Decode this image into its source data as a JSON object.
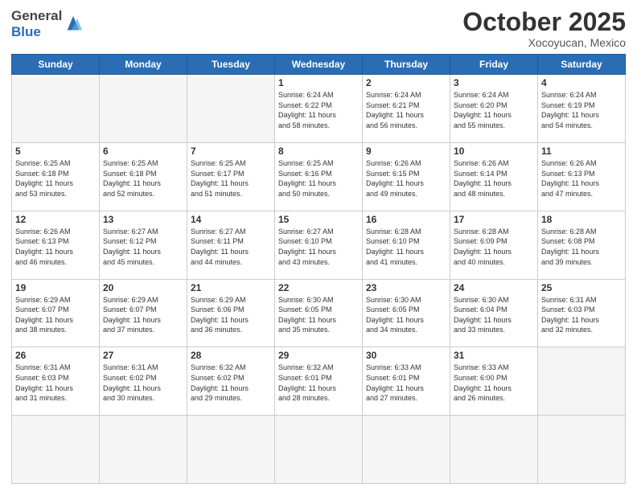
{
  "header": {
    "logo_general": "General",
    "logo_blue": "Blue",
    "month": "October 2025",
    "location": "Xocoyucan, Mexico"
  },
  "weekdays": [
    "Sunday",
    "Monday",
    "Tuesday",
    "Wednesday",
    "Thursday",
    "Friday",
    "Saturday"
  ],
  "days": [
    {
      "num": "",
      "info": ""
    },
    {
      "num": "",
      "info": ""
    },
    {
      "num": "",
      "info": ""
    },
    {
      "num": "1",
      "info": "Sunrise: 6:24 AM\nSunset: 6:22 PM\nDaylight: 11 hours\nand 58 minutes."
    },
    {
      "num": "2",
      "info": "Sunrise: 6:24 AM\nSunset: 6:21 PM\nDaylight: 11 hours\nand 56 minutes."
    },
    {
      "num": "3",
      "info": "Sunrise: 6:24 AM\nSunset: 6:20 PM\nDaylight: 11 hours\nand 55 minutes."
    },
    {
      "num": "4",
      "info": "Sunrise: 6:24 AM\nSunset: 6:19 PM\nDaylight: 11 hours\nand 54 minutes."
    },
    {
      "num": "5",
      "info": "Sunrise: 6:25 AM\nSunset: 6:18 PM\nDaylight: 11 hours\nand 53 minutes."
    },
    {
      "num": "6",
      "info": "Sunrise: 6:25 AM\nSunset: 6:18 PM\nDaylight: 11 hours\nand 52 minutes."
    },
    {
      "num": "7",
      "info": "Sunrise: 6:25 AM\nSunset: 6:17 PM\nDaylight: 11 hours\nand 51 minutes."
    },
    {
      "num": "8",
      "info": "Sunrise: 6:25 AM\nSunset: 6:16 PM\nDaylight: 11 hours\nand 50 minutes."
    },
    {
      "num": "9",
      "info": "Sunrise: 6:26 AM\nSunset: 6:15 PM\nDaylight: 11 hours\nand 49 minutes."
    },
    {
      "num": "10",
      "info": "Sunrise: 6:26 AM\nSunset: 6:14 PM\nDaylight: 11 hours\nand 48 minutes."
    },
    {
      "num": "11",
      "info": "Sunrise: 6:26 AM\nSunset: 6:13 PM\nDaylight: 11 hours\nand 47 minutes."
    },
    {
      "num": "12",
      "info": "Sunrise: 6:26 AM\nSunset: 6:13 PM\nDaylight: 11 hours\nand 46 minutes."
    },
    {
      "num": "13",
      "info": "Sunrise: 6:27 AM\nSunset: 6:12 PM\nDaylight: 11 hours\nand 45 minutes."
    },
    {
      "num": "14",
      "info": "Sunrise: 6:27 AM\nSunset: 6:11 PM\nDaylight: 11 hours\nand 44 minutes."
    },
    {
      "num": "15",
      "info": "Sunrise: 6:27 AM\nSunset: 6:10 PM\nDaylight: 11 hours\nand 43 minutes."
    },
    {
      "num": "16",
      "info": "Sunrise: 6:28 AM\nSunset: 6:10 PM\nDaylight: 11 hours\nand 41 minutes."
    },
    {
      "num": "17",
      "info": "Sunrise: 6:28 AM\nSunset: 6:09 PM\nDaylight: 11 hours\nand 40 minutes."
    },
    {
      "num": "18",
      "info": "Sunrise: 6:28 AM\nSunset: 6:08 PM\nDaylight: 11 hours\nand 39 minutes."
    },
    {
      "num": "19",
      "info": "Sunrise: 6:29 AM\nSunset: 6:07 PM\nDaylight: 11 hours\nand 38 minutes."
    },
    {
      "num": "20",
      "info": "Sunrise: 6:29 AM\nSunset: 6:07 PM\nDaylight: 11 hours\nand 37 minutes."
    },
    {
      "num": "21",
      "info": "Sunrise: 6:29 AM\nSunset: 6:06 PM\nDaylight: 11 hours\nand 36 minutes."
    },
    {
      "num": "22",
      "info": "Sunrise: 6:30 AM\nSunset: 6:05 PM\nDaylight: 11 hours\nand 35 minutes."
    },
    {
      "num": "23",
      "info": "Sunrise: 6:30 AM\nSunset: 6:05 PM\nDaylight: 11 hours\nand 34 minutes."
    },
    {
      "num": "24",
      "info": "Sunrise: 6:30 AM\nSunset: 6:04 PM\nDaylight: 11 hours\nand 33 minutes."
    },
    {
      "num": "25",
      "info": "Sunrise: 6:31 AM\nSunset: 6:03 PM\nDaylight: 11 hours\nand 32 minutes."
    },
    {
      "num": "26",
      "info": "Sunrise: 6:31 AM\nSunset: 6:03 PM\nDaylight: 11 hours\nand 31 minutes."
    },
    {
      "num": "27",
      "info": "Sunrise: 6:31 AM\nSunset: 6:02 PM\nDaylight: 11 hours\nand 30 minutes."
    },
    {
      "num": "28",
      "info": "Sunrise: 6:32 AM\nSunset: 6:02 PM\nDaylight: 11 hours\nand 29 minutes."
    },
    {
      "num": "29",
      "info": "Sunrise: 6:32 AM\nSunset: 6:01 PM\nDaylight: 11 hours\nand 28 minutes."
    },
    {
      "num": "30",
      "info": "Sunrise: 6:33 AM\nSunset: 6:01 PM\nDaylight: 11 hours\nand 27 minutes."
    },
    {
      "num": "31",
      "info": "Sunrise: 6:33 AM\nSunset: 6:00 PM\nDaylight: 11 hours\nand 26 minutes."
    },
    {
      "num": "",
      "info": ""
    },
    {
      "num": "",
      "info": ""
    }
  ]
}
